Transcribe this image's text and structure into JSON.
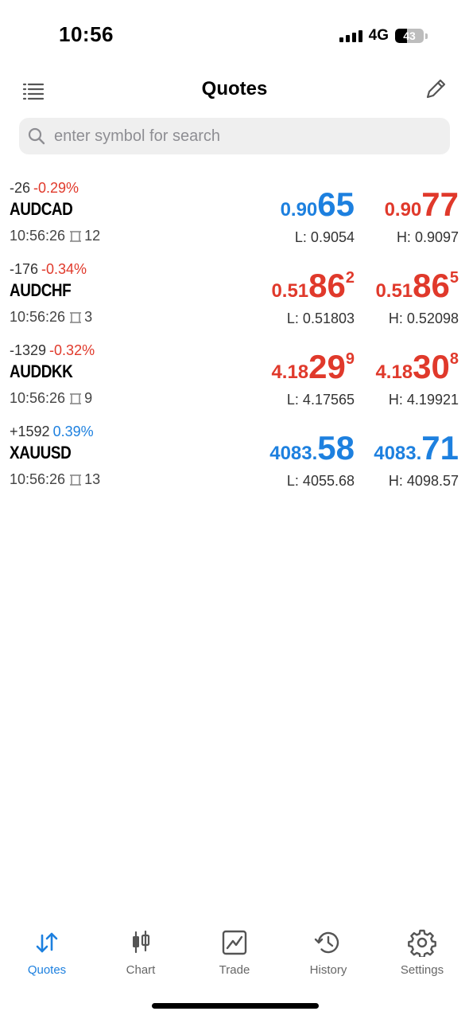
{
  "status": {
    "time": "10:56",
    "network": "4G",
    "battery": "43",
    "battery_level": 0.43
  },
  "nav": {
    "title": "Quotes",
    "left_icon": "list-icon",
    "right_icon": "pencil-icon"
  },
  "search": {
    "placeholder": "enter symbol for search",
    "value": ""
  },
  "quotes": [
    {
      "change": "-26",
      "pct": "-0.29%",
      "pct_color": "#e0392b",
      "symbol": "AUDCAD",
      "time": "10:56:26",
      "spread": "12",
      "bid": {
        "prefix": "0.90",
        "big": "65",
        "sup": "",
        "color": "#1d80df"
      },
      "ask": {
        "prefix": "0.90",
        "big": "77",
        "sup": "",
        "color": "#e0392b"
      },
      "low": "L: 0.9054",
      "high": "H: 0.9097"
    },
    {
      "change": "-176",
      "pct": "-0.34%",
      "pct_color": "#e0392b",
      "symbol": "AUDCHF",
      "time": "10:56:26",
      "spread": "3",
      "bid": {
        "prefix": "0.51",
        "big": "86",
        "sup": "2",
        "color": "#e0392b"
      },
      "ask": {
        "prefix": "0.51",
        "big": "86",
        "sup": "5",
        "color": "#e0392b"
      },
      "low": "L: 0.51803",
      "high": "H: 0.52098"
    },
    {
      "change": "-1329",
      "pct": "-0.32%",
      "pct_color": "#e0392b",
      "symbol": "AUDDKK",
      "time": "10:56:26",
      "spread": "9",
      "bid": {
        "prefix": "4.18",
        "big": "29",
        "sup": "9",
        "color": "#e0392b"
      },
      "ask": {
        "prefix": "4.18",
        "big": "30",
        "sup": "8",
        "color": "#e0392b"
      },
      "low": "L: 4.17565",
      "high": "H: 4.19921"
    },
    {
      "change": "+1592",
      "pct": "0.39%",
      "pct_color": "#1d80df",
      "symbol": "XAUUSD",
      "time": "10:56:26",
      "spread": "13",
      "bid": {
        "prefix": "4083.",
        "big": "58",
        "sup": "",
        "color": "#1d80df"
      },
      "ask": {
        "prefix": "4083.",
        "big": "71",
        "sup": "",
        "color": "#1d80df"
      },
      "low": "L: 4055.68",
      "high": "H: 4098.57"
    }
  ],
  "tabs": [
    {
      "label": "Quotes",
      "icon": "quotes-arrows-icon",
      "active": true
    },
    {
      "label": "Chart",
      "icon": "candlestick-icon",
      "active": false
    },
    {
      "label": "Trade",
      "icon": "trade-chart-icon",
      "active": false
    },
    {
      "label": "History",
      "icon": "history-clock-icon",
      "active": false
    },
    {
      "label": "Settings",
      "icon": "gear-icon",
      "active": false
    }
  ],
  "colors": {
    "accent": "#1d80df",
    "down": "#e0392b",
    "up": "#1d80df"
  }
}
